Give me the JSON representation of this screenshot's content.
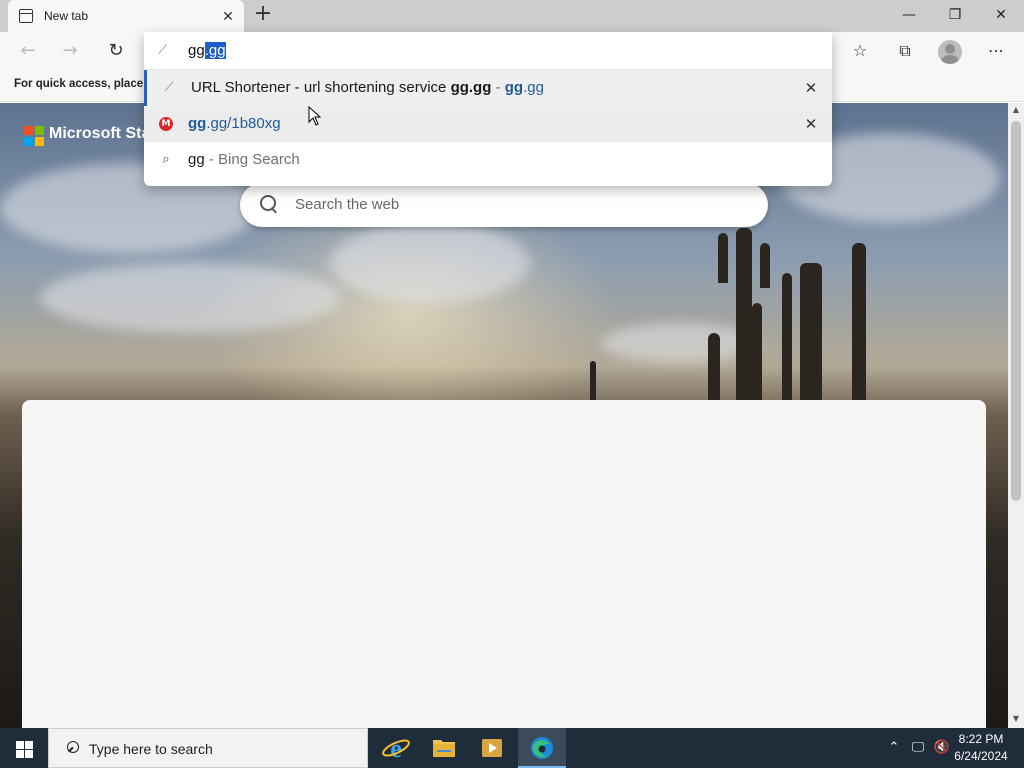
{
  "tab": {
    "title": "New tab"
  },
  "window_controls": {
    "minimize": "—",
    "restore": "❐",
    "close": "✕"
  },
  "favorites_bar": {
    "text": "For quick access, place y"
  },
  "omnibox": {
    "typed_prefix": "gg",
    "typed_selected": ".gg",
    "suggestions": [
      {
        "type": "url",
        "title": "URL Shortener - url shortening service ",
        "title_bold": "gg.gg",
        "separator": " - ",
        "url_bold": "gg",
        "url_rest": ".gg",
        "remove": "✕"
      },
      {
        "type": "history",
        "icon_letter": "M",
        "url_bold": "gg",
        "url_rest": ".gg/1b80xg",
        "remove": "✕"
      },
      {
        "type": "search",
        "query": "gg",
        "suffix": " - Bing Search"
      }
    ]
  },
  "new_tab_page": {
    "brand": "Microsoft Sta",
    "search_placeholder": "Search the web"
  },
  "taskbar": {
    "search_placeholder": "Type here to search",
    "clock_time": "8:22 PM",
    "clock_date": "6/24/2024"
  },
  "colors": {
    "accent": "#1e5ec8",
    "taskbar": "#1f2c3a",
    "tabbar": "#cdcdcd",
    "link_blue": "#1f5c99"
  }
}
